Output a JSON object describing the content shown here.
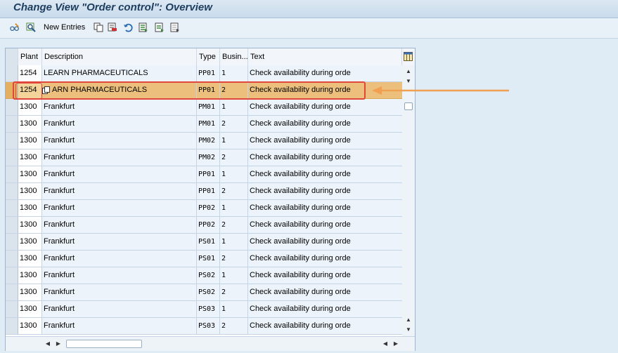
{
  "title": "Change View \"Order control\": Overview",
  "toolbar": {
    "new_entries_label": "New Entries",
    "icons": [
      "glasses-edit-icon",
      "display-change-icon",
      "copy-icon",
      "delete-icon",
      "undo-icon",
      "select-all-icon",
      "select-block-icon",
      "deselect-all-icon"
    ]
  },
  "table": {
    "columns": [
      "Plant",
      "Description",
      "Type",
      "Busin...",
      "Text"
    ],
    "rows": [
      {
        "plant": "1254",
        "description": "LEARN PHARMACEUTICALS",
        "type": "PP01",
        "bus": "1",
        "text": "Check availability during orde"
      },
      {
        "plant": "1254",
        "description": "ARN PHARMACEUTICALS",
        "type": "PP01",
        "bus": "2",
        "text": "Check availability during orde",
        "selected": true
      },
      {
        "plant": "1300",
        "description": "Frankfurt",
        "type": "PM01",
        "bus": "1",
        "text": "Check availability during orde"
      },
      {
        "plant": "1300",
        "description": "Frankfurt",
        "type": "PM01",
        "bus": "2",
        "text": "Check availability during orde"
      },
      {
        "plant": "1300",
        "description": "Frankfurt",
        "type": "PM02",
        "bus": "1",
        "text": "Check availability during orde"
      },
      {
        "plant": "1300",
        "description": "Frankfurt",
        "type": "PM02",
        "bus": "2",
        "text": "Check availability during orde"
      },
      {
        "plant": "1300",
        "description": "Frankfurt",
        "type": "PP01",
        "bus": "1",
        "text": "Check availability during orde"
      },
      {
        "plant": "1300",
        "description": "Frankfurt",
        "type": "PP01",
        "bus": "2",
        "text": "Check availability during orde"
      },
      {
        "plant": "1300",
        "description": "Frankfurt",
        "type": "PP02",
        "bus": "1",
        "text": "Check availability during orde"
      },
      {
        "plant": "1300",
        "description": "Frankfurt",
        "type": "PP02",
        "bus": "2",
        "text": "Check availability during orde"
      },
      {
        "plant": "1300",
        "description": "Frankfurt",
        "type": "PS01",
        "bus": "1",
        "text": "Check availability during orde"
      },
      {
        "plant": "1300",
        "description": "Frankfurt",
        "type": "PS01",
        "bus": "2",
        "text": "Check availability during orde"
      },
      {
        "plant": "1300",
        "description": "Frankfurt",
        "type": "PS02",
        "bus": "1",
        "text": "Check availability during orde"
      },
      {
        "plant": "1300",
        "description": "Frankfurt",
        "type": "PS02",
        "bus": "2",
        "text": "Check availability during orde"
      },
      {
        "plant": "1300",
        "description": "Frankfurt",
        "type": "PS03",
        "bus": "1",
        "text": "Check availability during orde"
      },
      {
        "plant": "1300",
        "description": "Frankfurt",
        "type": "PS03",
        "bus": "2",
        "text": "Check availability during orde"
      }
    ]
  },
  "colors": {
    "selected_row": "#ecc07c",
    "highlight_box": "#e0463c",
    "arrow": "#f0a050"
  }
}
